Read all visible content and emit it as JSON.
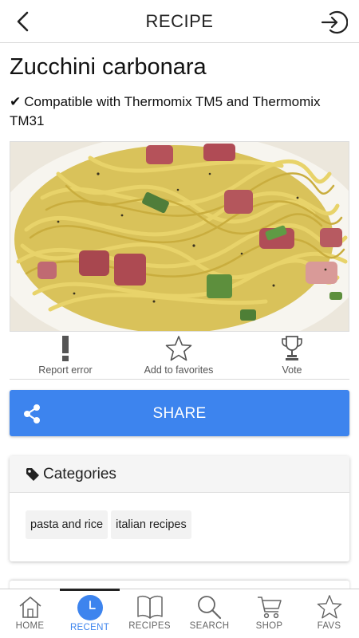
{
  "header": {
    "title": "RECIPE"
  },
  "recipe": {
    "title": "Zucchini carbonara",
    "compat_check": "✔",
    "compatibility": "Compatible with Thermomix TM5 and Thermomix TM31"
  },
  "actions": [
    {
      "label": "Report error",
      "icon": "exclamation-icon"
    },
    {
      "label": "Add to favorites",
      "icon": "star-outline-icon"
    },
    {
      "label": "Vote",
      "icon": "trophy-icon"
    }
  ],
  "share": {
    "label": "SHARE",
    "color": "#3d84ee"
  },
  "categories": {
    "title": "Categories",
    "tags": [
      "pasta and rice",
      "italian recipes"
    ]
  },
  "nav": [
    {
      "label": "HOME",
      "icon": "home-icon",
      "active": false
    },
    {
      "label": "RECENT",
      "icon": "clock-icon",
      "active": true
    },
    {
      "label": "RECIPES",
      "icon": "book-icon",
      "active": false
    },
    {
      "label": "SEARCH",
      "icon": "search-icon",
      "active": false
    },
    {
      "label": "SHOP",
      "icon": "cart-icon",
      "active": false
    },
    {
      "label": "FAVS",
      "icon": "star-icon",
      "active": false
    }
  ],
  "colors": {
    "accent": "#3d84ee",
    "text": "#222222"
  }
}
